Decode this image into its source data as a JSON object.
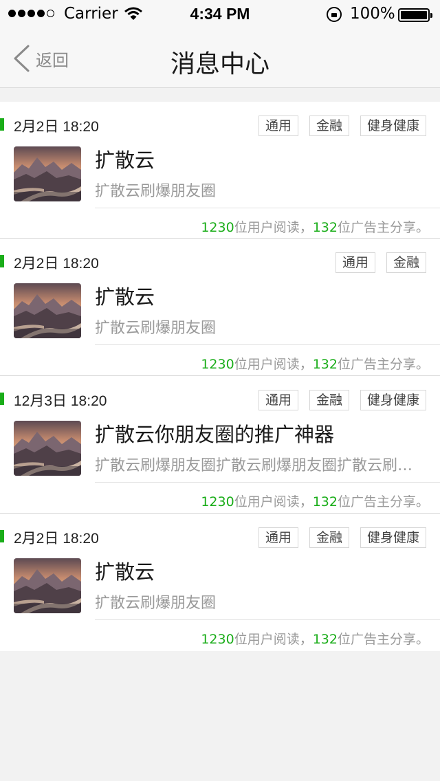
{
  "status_bar": {
    "carrier": "Carrier",
    "time": "4:34 PM",
    "battery": "100%"
  },
  "nav": {
    "back_label": "返回",
    "title": "消息中心"
  },
  "colors": {
    "accent": "#1aad19",
    "muted": "#999999"
  },
  "messages": [
    {
      "date": "2月2日 18:20",
      "tags": [
        "通用",
        "金融",
        "健身健康"
      ],
      "title": "扩散云",
      "desc": "扩散云刷爆朋友圈",
      "reads": "1230",
      "reads_label": "位用户阅读，",
      "shares": "132",
      "shares_label": "位广告主分享。"
    },
    {
      "date": "2月2日 18:20",
      "tags": [
        "通用",
        "金融"
      ],
      "title": "扩散云",
      "desc": "扩散云刷爆朋友圈",
      "reads": "1230",
      "reads_label": "位用户阅读，",
      "shares": "132",
      "shares_label": "位广告主分享。"
    },
    {
      "date": "12月3日 18:20",
      "tags": [
        "通用",
        "金融",
        "健身健康"
      ],
      "title": "扩散云你朋友圈的推广神器",
      "desc": "扩散云刷爆朋友圈扩散云刷爆朋友圈扩散云刷爆朋友圈",
      "reads": "1230",
      "reads_label": "位用户阅读，",
      "shares": "132",
      "shares_label": "位广告主分享。"
    },
    {
      "date": "2月2日 18:20",
      "tags": [
        "通用",
        "金融",
        "健身健康"
      ],
      "title": "扩散云",
      "desc": "扩散云刷爆朋友圈",
      "reads": "1230",
      "reads_label": "位用户阅读，",
      "shares": "132",
      "shares_label": "位广告主分享。"
    }
  ]
}
